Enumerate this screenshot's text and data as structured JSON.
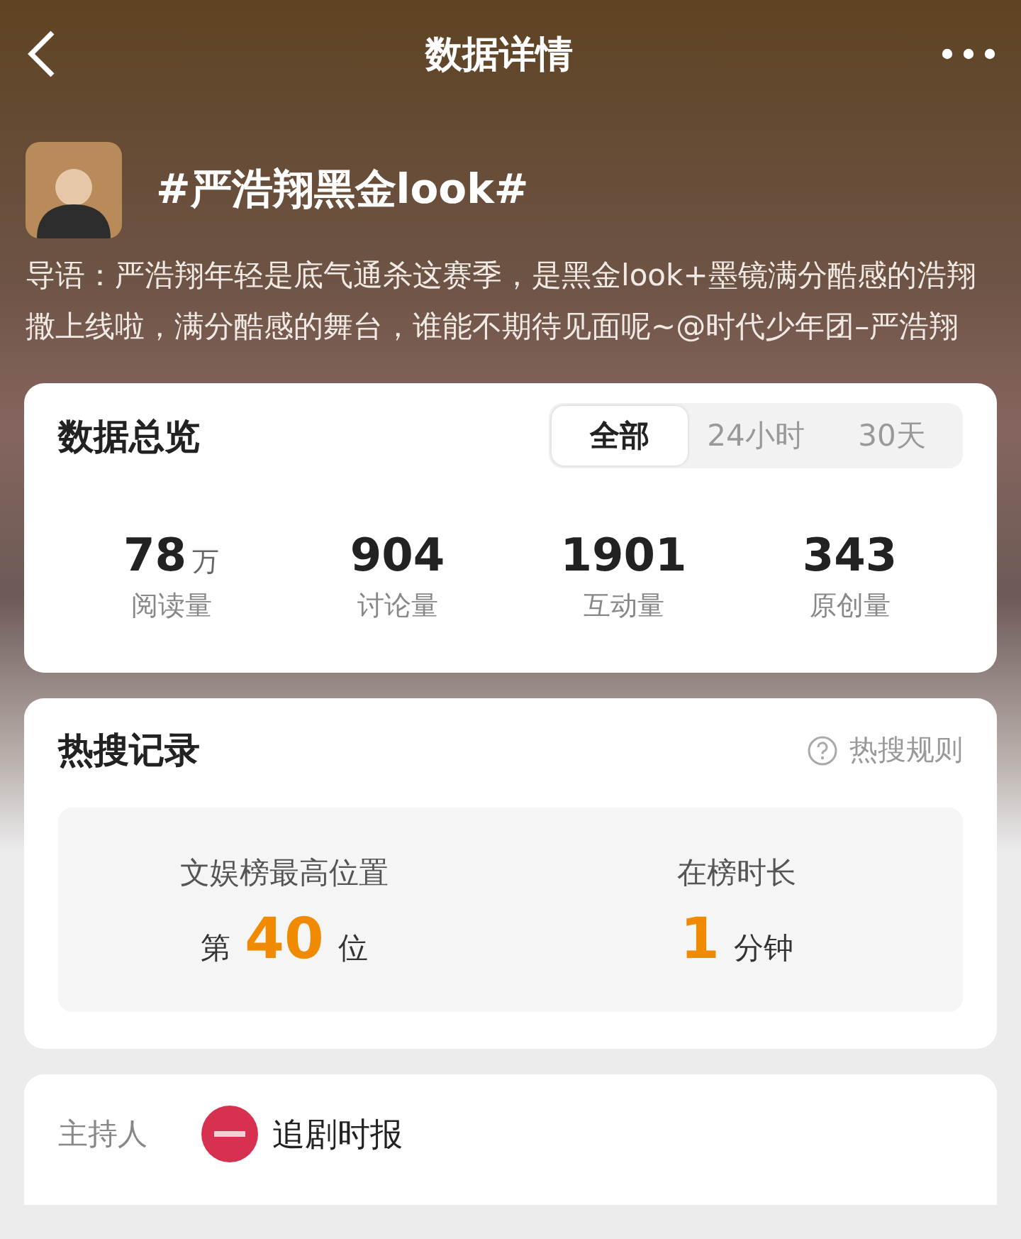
{
  "header": {
    "title": "数据详情"
  },
  "topic": {
    "title": "#严浩翔黑金look#",
    "intro": "导语：严浩翔年轻是底气通杀这赛季，是黑金look+墨镜满分酷感的浩翔撒上线啦，满分酷感的舞台，谁能不期待见面呢~@时代少年团–严浩翔"
  },
  "overview": {
    "title": "数据总览",
    "tabs": [
      {
        "label": "全部",
        "selected": true
      },
      {
        "label": "24小时",
        "selected": false
      },
      {
        "label": "30天",
        "selected": false
      }
    ],
    "stats": [
      {
        "value": "78",
        "unit": "万",
        "label": "阅读量"
      },
      {
        "value": "904",
        "label": "讨论量"
      },
      {
        "value": "1901",
        "label": "互动量"
      },
      {
        "value": "343",
        "label": "原创量"
      }
    ]
  },
  "hot_search": {
    "title": "热搜记录",
    "rules_link": "热搜规则",
    "items": [
      {
        "label": "文娱榜最高位置",
        "prefix": "第",
        "value": "40",
        "suffix": "位"
      },
      {
        "label": "在榜时长",
        "value": "1",
        "suffix": "分钟"
      }
    ]
  },
  "host": {
    "label": "主持人",
    "name": "追剧时报"
  }
}
